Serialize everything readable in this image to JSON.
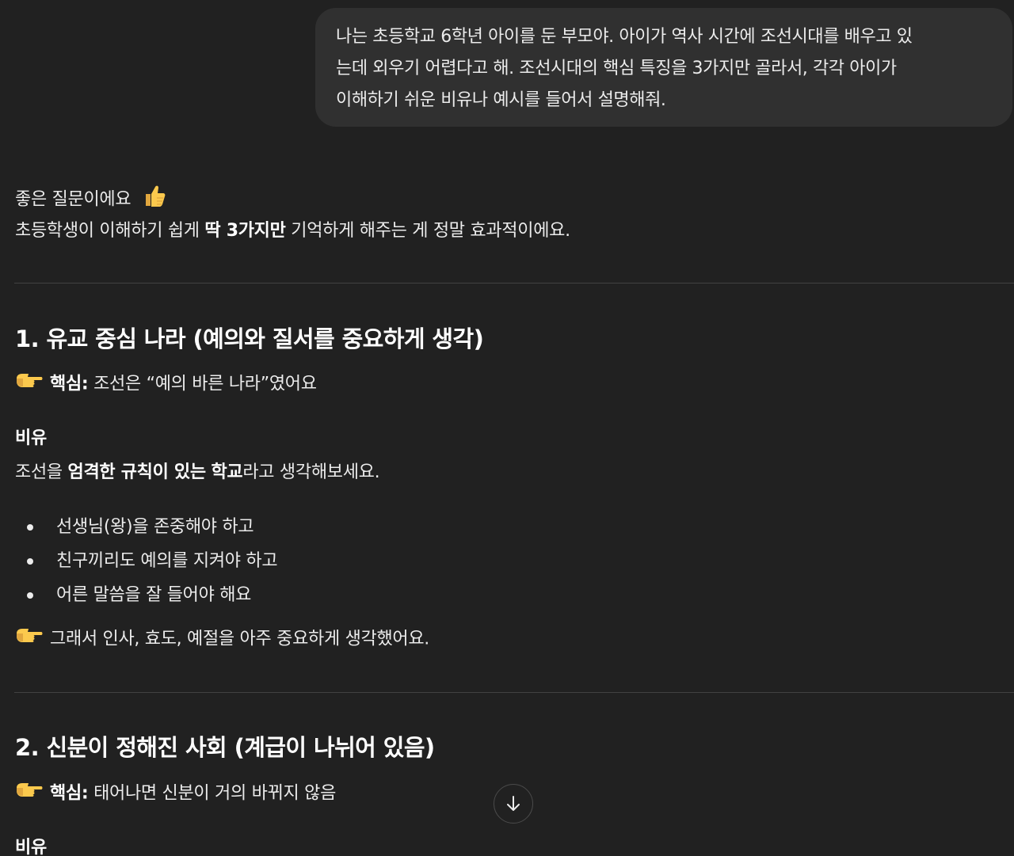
{
  "user_message": {
    "lines": [
      "나는 초등학교 6학년 아이를 둔 부모야. 아이가 역사 시간에 조선시대를 배우고 있",
      "는데 외우기 어렵다고 해. 조선시대의 핵심 특징을 3가지만 골라서, 각각 아이가",
      "이해하기 쉬운 비유나 예시를 들어서 설명해줘."
    ]
  },
  "assistant": {
    "greeting": "좋은 질문이에요",
    "intro": {
      "before": "초등학생이 이해하기 쉽게 ",
      "bold": "딱 3가지만",
      "after": " 기억하게 해주는 게 정말 효과적이에요."
    },
    "section1": {
      "heading": "1. 유교 중심 나라 (예의와 질서를 중요하게 생각)",
      "core_label": "핵심:",
      "core_text": " 조선은 “예의 바른 나라”였어요",
      "analogy_heading": "비유",
      "analogy": {
        "p1": "조선을 ",
        "b1": "엄격한 규칙이 있는",
        "p2": " ",
        "b2": "학교",
        "p3": "라고 생각해보세요."
      },
      "bullets": [
        "선생님(왕)을 존중해야 하고",
        "친구끼리도 예의를 지켜야 하고",
        "어른 말씀을 잘 들어야 해요"
      ],
      "conclusion": "그래서 인사, 효도, 예절을 아주 중요하게 생각했어요."
    },
    "section2": {
      "heading": "2. 신분이 정해진 사회 (계급이 나뉘어 있음)",
      "core_label": "핵심:",
      "core_text": " 태어나면 신분이 거의 바뀌지 않음",
      "analogy_heading": "비유"
    }
  },
  "icons": {
    "thumbs_up": "thumbs-up-icon",
    "pointing": "pointing-right-icon",
    "scroll_down": "arrow-down-icon"
  }
}
